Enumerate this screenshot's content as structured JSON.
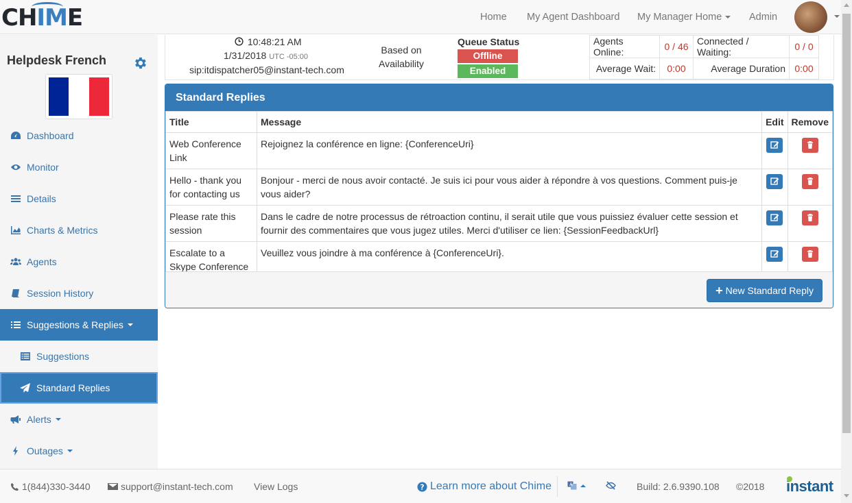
{
  "app": {
    "logo_text_pre": "CH",
    "logo_text_hi": "IM",
    "logo_text_post": "E"
  },
  "nav": {
    "home": "Home",
    "agent_dashboard": "My Agent Dashboard",
    "manager_home": "My Manager Home",
    "admin": "Admin"
  },
  "sidebar": {
    "queue_name": "Helpdesk French",
    "flag_colors": [
      "#002395",
      "#ffffff",
      "#ed2939"
    ],
    "items": [
      {
        "label": "Dashboard",
        "icon": "dashboard-icon"
      },
      {
        "label": "Monitor",
        "icon": "eye-icon"
      },
      {
        "label": "Details",
        "icon": "list-icon"
      },
      {
        "label": "Charts & Metrics",
        "icon": "area-chart-icon"
      },
      {
        "label": "Agents",
        "icon": "users-icon"
      },
      {
        "label": "Session History",
        "icon": "book-icon"
      },
      {
        "label": "Suggestions & Replies",
        "icon": "tasks-icon"
      },
      {
        "label": "Suggestions",
        "icon": "list-alt-icon"
      },
      {
        "label": "Standard Replies",
        "icon": "paper-plane-icon"
      },
      {
        "label": "Alerts",
        "icon": "bullhorn-icon"
      },
      {
        "label": "Outages",
        "icon": "bolt-icon"
      }
    ]
  },
  "header": {
    "time": "10:48:21 AM",
    "date": "1/31/2018",
    "timezone": "UTC -05:00",
    "sip": "sip:itdispatcher05@instant-tech.com",
    "routing_line1": "Based on",
    "routing_line2": "Availability",
    "queue_status_title": "Queue Status",
    "status_offline": "Offline",
    "status_enabled": "Enabled",
    "offline_color": "#d9534f",
    "enabled_color": "#5cb85c",
    "stats": {
      "agents_online_label": "Agents Online:",
      "agents_online_value": "0 / 46",
      "connected_waiting_label": "Connected / Waiting:",
      "connected_waiting_value": "0 / 0",
      "average_wait_label": "Average Wait:",
      "average_wait_value": "0:00",
      "average_duration_label": "Average Duration",
      "average_duration_value": "0:00"
    }
  },
  "panel": {
    "title": "Standard Replies",
    "columns": {
      "title": "Title",
      "message": "Message",
      "edit": "Edit",
      "remove": "Remove"
    },
    "rows": [
      {
        "title": "Web Conference Link",
        "message": "Rejoignez la conférence en ligne: {ConferenceUri}"
      },
      {
        "title": "Hello - thank you for contacting us",
        "message": "Bonjour - merci de nous avoir contacté. Je suis ici pour vous aider à répondre à vos questions. Comment puis-je vous aider?"
      },
      {
        "title": "Please rate this session",
        "message": "Dans le cadre de notre processus de rétroaction continu, il serait utile que vous puissiez évaluer cette session et fournir des commentaires que vous jugez utiles. Merci d'utiliser ce lien: {SessionFeedbackUrl}"
      },
      {
        "title": "Escalate to a Skype Conference",
        "message": "Veuillez vous joindre à ma conférence à {ConferenceUri}."
      }
    ],
    "new_button": "New Standard Reply"
  },
  "footer": {
    "phone": "1(844)330-3440",
    "email": "support@instant-tech.com",
    "view_logs": "View Logs",
    "learn_more": "Learn more about Chime",
    "build": "Build: 2.6.9390.108",
    "copyright": "©2018",
    "brand": "instant"
  }
}
